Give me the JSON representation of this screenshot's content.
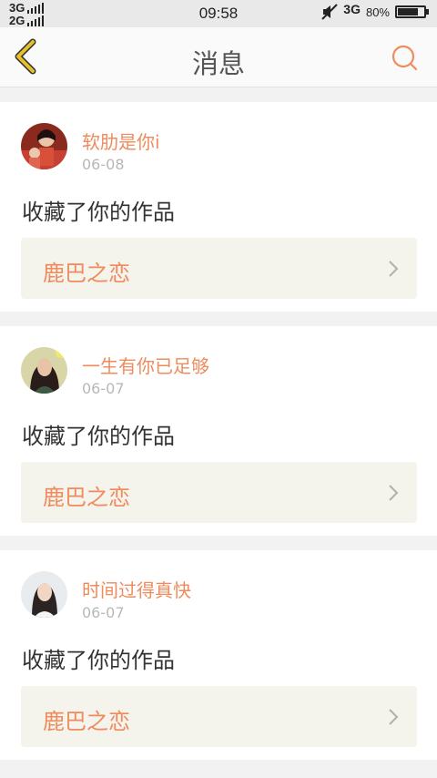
{
  "status_bar": {
    "network_top": "3G",
    "network_bottom": "2G",
    "time": "09:58",
    "network_right": "3G",
    "battery": "80%",
    "battery_level": 0.8,
    "icons": [
      "signal-icon",
      "mute-icon",
      "battery-icon"
    ]
  },
  "header": {
    "title": "消息",
    "back_icon": "chevron-left-icon",
    "search_icon": "search-icon",
    "accent_color": "#ef8b5c",
    "back_color": "#e6c02a"
  },
  "messages": [
    {
      "username": "软肋是你i",
      "date": "06-08",
      "action": "收藏了你的作品",
      "work_title": "鹿巴之恋"
    },
    {
      "username": "一生有你已足够",
      "date": "06-07",
      "action": "收藏了你的作品",
      "work_title": "鹿巴之恋"
    },
    {
      "username": "时间过得真快",
      "date": "06-07",
      "action": "收藏了你的作品",
      "work_title": "鹿巴之恋"
    }
  ]
}
